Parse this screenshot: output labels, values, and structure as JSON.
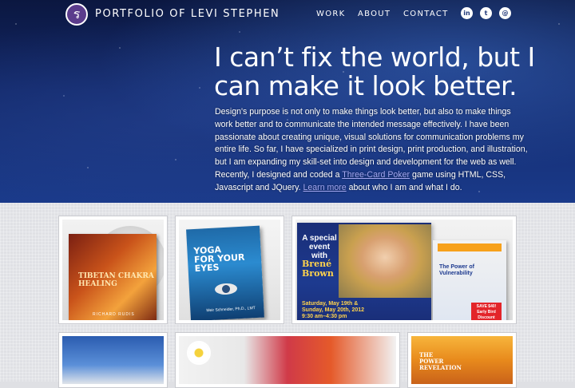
{
  "header": {
    "logo_glyph": "ร",
    "site_title": "PORTFOLIO OF LEVI STEPHEN",
    "nav": [
      {
        "label": "WORK"
      },
      {
        "label": "ABOUT"
      },
      {
        "label": "CONTACT"
      }
    ],
    "social": [
      {
        "icon": "linkedin-icon",
        "glyph": "in"
      },
      {
        "icon": "twitter-icon",
        "glyph": "t"
      },
      {
        "icon": "email-icon",
        "glyph": "@"
      }
    ]
  },
  "hero": {
    "headline": "I can’t fix the world, but I can make it look better.",
    "intro_part1": "Design's purpose is not only to make things look better, but also to make things work better and to communicate the intended message effectively. I have been passionate about creating unique, visual solutions for communication problems my entire life. So far, I have specialized in print design, print production, and illustration, but I am expanding my skill-set into design and development for the web as well. Recently, I designed and coded a ",
    "intro_link1": "Three-Card Poker",
    "intro_part2": " game using HTML, CSS, Javascript and JQuery. ",
    "intro_link2": "Learn more",
    "intro_part3": " about who I am and what I do."
  },
  "portfolio": {
    "tile1": {
      "title_line1": "TIBETAN CHAKRA",
      "title_line2": "HEALING",
      "author": "RICHARD RUDIS"
    },
    "tile2": {
      "title_line1": "YOGA",
      "title_line2": "FOR YOUR",
      "title_line3": "EYES",
      "author": "Meir Schneider, Ph.D., LMT"
    },
    "tile3": {
      "poster_text": "A special event with",
      "poster_name_1": "Brené",
      "poster_name_2": "Brown",
      "poster_date_1": "Saturday, May 19th &",
      "poster_date_2": "Sunday, May 20th, 2012",
      "poster_date_3": "9:30 am–4:30 pm",
      "brochure_title_1": "The Power of",
      "brochure_title_2": "Vulnerability",
      "brochure_save": "SAVE $40! Early Bird Discount"
    },
    "tile6": {
      "title_line1": "THE",
      "title_line2": "POWER",
      "title_line3": "REVELATION"
    }
  },
  "colors": {
    "accent_link": "#a3a8f3",
    "logo_bg": "#5b3c8c",
    "hero_bg": "#13296a"
  }
}
